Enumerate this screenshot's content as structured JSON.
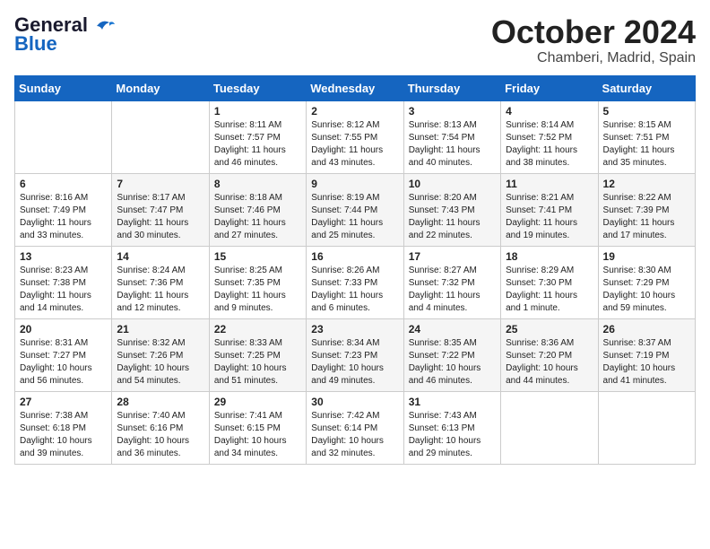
{
  "header": {
    "logo_line1": "General",
    "logo_line2": "Blue",
    "month": "October 2024",
    "location": "Chamberi, Madrid, Spain"
  },
  "weekdays": [
    "Sunday",
    "Monday",
    "Tuesday",
    "Wednesday",
    "Thursday",
    "Friday",
    "Saturday"
  ],
  "weeks": [
    [
      {
        "day": "",
        "info": ""
      },
      {
        "day": "",
        "info": ""
      },
      {
        "day": "1",
        "info": "Sunrise: 8:11 AM\nSunset: 7:57 PM\nDaylight: 11 hours and 46 minutes."
      },
      {
        "day": "2",
        "info": "Sunrise: 8:12 AM\nSunset: 7:55 PM\nDaylight: 11 hours and 43 minutes."
      },
      {
        "day": "3",
        "info": "Sunrise: 8:13 AM\nSunset: 7:54 PM\nDaylight: 11 hours and 40 minutes."
      },
      {
        "day": "4",
        "info": "Sunrise: 8:14 AM\nSunset: 7:52 PM\nDaylight: 11 hours and 38 minutes."
      },
      {
        "day": "5",
        "info": "Sunrise: 8:15 AM\nSunset: 7:51 PM\nDaylight: 11 hours and 35 minutes."
      }
    ],
    [
      {
        "day": "6",
        "info": "Sunrise: 8:16 AM\nSunset: 7:49 PM\nDaylight: 11 hours and 33 minutes."
      },
      {
        "day": "7",
        "info": "Sunrise: 8:17 AM\nSunset: 7:47 PM\nDaylight: 11 hours and 30 minutes."
      },
      {
        "day": "8",
        "info": "Sunrise: 8:18 AM\nSunset: 7:46 PM\nDaylight: 11 hours and 27 minutes."
      },
      {
        "day": "9",
        "info": "Sunrise: 8:19 AM\nSunset: 7:44 PM\nDaylight: 11 hours and 25 minutes."
      },
      {
        "day": "10",
        "info": "Sunrise: 8:20 AM\nSunset: 7:43 PM\nDaylight: 11 hours and 22 minutes."
      },
      {
        "day": "11",
        "info": "Sunrise: 8:21 AM\nSunset: 7:41 PM\nDaylight: 11 hours and 19 minutes."
      },
      {
        "day": "12",
        "info": "Sunrise: 8:22 AM\nSunset: 7:39 PM\nDaylight: 11 hours and 17 minutes."
      }
    ],
    [
      {
        "day": "13",
        "info": "Sunrise: 8:23 AM\nSunset: 7:38 PM\nDaylight: 11 hours and 14 minutes."
      },
      {
        "day": "14",
        "info": "Sunrise: 8:24 AM\nSunset: 7:36 PM\nDaylight: 11 hours and 12 minutes."
      },
      {
        "day": "15",
        "info": "Sunrise: 8:25 AM\nSunset: 7:35 PM\nDaylight: 11 hours and 9 minutes."
      },
      {
        "day": "16",
        "info": "Sunrise: 8:26 AM\nSunset: 7:33 PM\nDaylight: 11 hours and 6 minutes."
      },
      {
        "day": "17",
        "info": "Sunrise: 8:27 AM\nSunset: 7:32 PM\nDaylight: 11 hours and 4 minutes."
      },
      {
        "day": "18",
        "info": "Sunrise: 8:29 AM\nSunset: 7:30 PM\nDaylight: 11 hours and 1 minute."
      },
      {
        "day": "19",
        "info": "Sunrise: 8:30 AM\nSunset: 7:29 PM\nDaylight: 10 hours and 59 minutes."
      }
    ],
    [
      {
        "day": "20",
        "info": "Sunrise: 8:31 AM\nSunset: 7:27 PM\nDaylight: 10 hours and 56 minutes."
      },
      {
        "day": "21",
        "info": "Sunrise: 8:32 AM\nSunset: 7:26 PM\nDaylight: 10 hours and 54 minutes."
      },
      {
        "day": "22",
        "info": "Sunrise: 8:33 AM\nSunset: 7:25 PM\nDaylight: 10 hours and 51 minutes."
      },
      {
        "day": "23",
        "info": "Sunrise: 8:34 AM\nSunset: 7:23 PM\nDaylight: 10 hours and 49 minutes."
      },
      {
        "day": "24",
        "info": "Sunrise: 8:35 AM\nSunset: 7:22 PM\nDaylight: 10 hours and 46 minutes."
      },
      {
        "day": "25",
        "info": "Sunrise: 8:36 AM\nSunset: 7:20 PM\nDaylight: 10 hours and 44 minutes."
      },
      {
        "day": "26",
        "info": "Sunrise: 8:37 AM\nSunset: 7:19 PM\nDaylight: 10 hours and 41 minutes."
      }
    ],
    [
      {
        "day": "27",
        "info": "Sunrise: 7:38 AM\nSunset: 6:18 PM\nDaylight: 10 hours and 39 minutes."
      },
      {
        "day": "28",
        "info": "Sunrise: 7:40 AM\nSunset: 6:16 PM\nDaylight: 10 hours and 36 minutes."
      },
      {
        "day": "29",
        "info": "Sunrise: 7:41 AM\nSunset: 6:15 PM\nDaylight: 10 hours and 34 minutes."
      },
      {
        "day": "30",
        "info": "Sunrise: 7:42 AM\nSunset: 6:14 PM\nDaylight: 10 hours and 32 minutes."
      },
      {
        "day": "31",
        "info": "Sunrise: 7:43 AM\nSunset: 6:13 PM\nDaylight: 10 hours and 29 minutes."
      },
      {
        "day": "",
        "info": ""
      },
      {
        "day": "",
        "info": ""
      }
    ]
  ]
}
